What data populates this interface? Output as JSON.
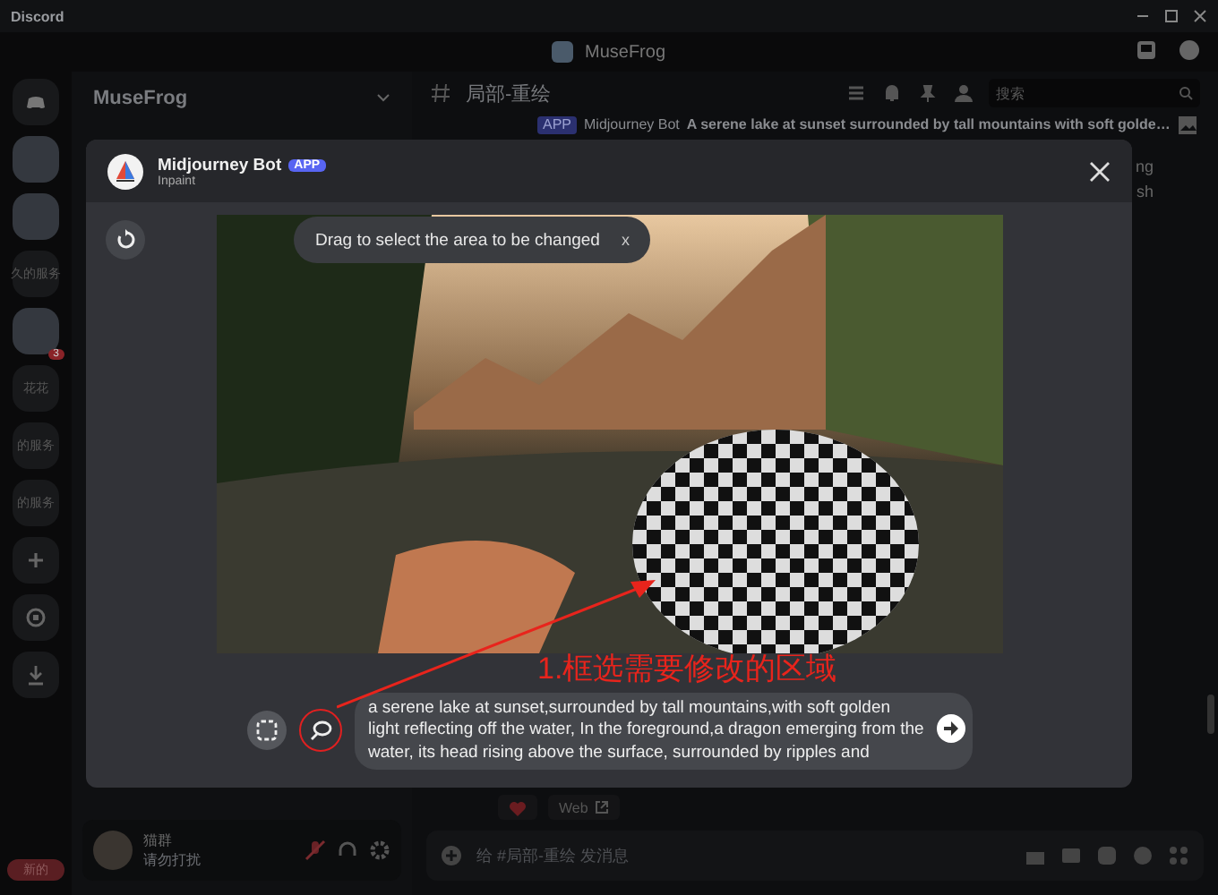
{
  "window": {
    "title": "Discord",
    "server_title": "MuseFrog"
  },
  "server_rail": {
    "items": [
      {
        "kind": "home"
      },
      {
        "kind": "avatar"
      },
      {
        "kind": "avatar"
      },
      {
        "kind": "label",
        "label": "久的服务"
      },
      {
        "kind": "avatar",
        "badge": "3"
      },
      {
        "kind": "label",
        "label": "花花"
      },
      {
        "kind": "label",
        "label": "的服务"
      },
      {
        "kind": "label",
        "label": "的服务"
      },
      {
        "kind": "add"
      },
      {
        "kind": "explore"
      },
      {
        "kind": "download"
      }
    ],
    "new_badge": "新的"
  },
  "channel_sidebar": {
    "server_name": "MuseFrog"
  },
  "user_panel": {
    "name": "猫群",
    "status": "请勿打扰"
  },
  "channel": {
    "name": "局部-重绘",
    "search_placeholder": "搜索"
  },
  "message": {
    "tag": "APP",
    "author": "Midjourney Bot",
    "text": "A serene lake at sunset surrounded by tall mountains with soft golde…",
    "fragments": [
      "ng",
      "sh"
    ]
  },
  "web_button": "Web",
  "composer": {
    "placeholder": "给 #局部-重绘 发消息"
  },
  "modal": {
    "bot_name": "Midjourney Bot",
    "tag": "APP",
    "subtitle": "Inpaint",
    "hint": "Drag to select the area to be changed",
    "hint_close": "x",
    "prompt": "a serene lake at sunset,surrounded by tall mountains,with soft golden light reflecting off the water, In the foreground,a dragon emerging from the water, its head rising above the surface, surrounded by ripples and",
    "tools": [
      {
        "kind": "rectangle"
      },
      {
        "kind": "lasso"
      }
    ]
  },
  "annotation": {
    "text": "1.框选需要修改的区域"
  }
}
